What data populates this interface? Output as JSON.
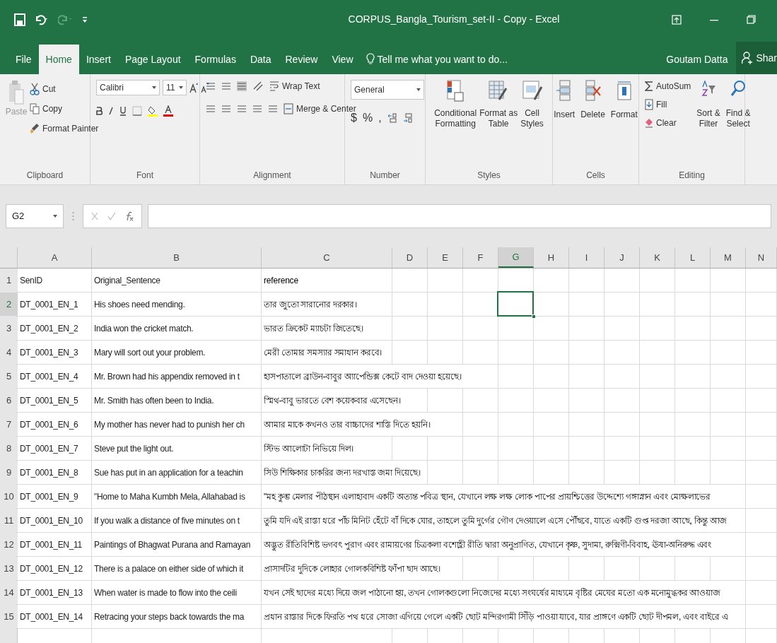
{
  "window": {
    "title": "CORPUS_Bangla_Tourism_set-II - Copy - Excel"
  },
  "tabs": [
    {
      "label": "File",
      "selected": false
    },
    {
      "label": "Home",
      "selected": true
    },
    {
      "label": "Insert",
      "selected": false
    },
    {
      "label": "Page Layout",
      "selected": false
    },
    {
      "label": "Formulas",
      "selected": false
    },
    {
      "label": "Data",
      "selected": false
    },
    {
      "label": "Review",
      "selected": false
    },
    {
      "label": "View",
      "selected": false
    }
  ],
  "tell_me": "Tell me what you want to do...",
  "user": "Goutam Datta",
  "share": "Shar",
  "ribbon": {
    "clipboard": {
      "label": "Clipboard",
      "paste": "Paste",
      "cut": "Cut",
      "copy": "Copy",
      "format_painter": "Format Painter"
    },
    "font": {
      "label": "Font",
      "font_name": "Calibri",
      "font_size": "11"
    },
    "alignment": {
      "label": "Alignment",
      "wrap_text": "Wrap Text",
      "merge_center": "Merge & Center"
    },
    "number": {
      "label": "Number",
      "format": "General",
      "currency": "$",
      "percent": "%",
      "comma": ","
    },
    "styles": {
      "label": "Styles",
      "buttons": [
        {
          "line1": "Conditional",
          "line2": "Formatting"
        },
        {
          "line1": "Format as",
          "line2": "Table"
        },
        {
          "line1": "Cell",
          "line2": "Styles"
        }
      ]
    },
    "cells": {
      "label": "Cells",
      "buttons": [
        "Insert",
        "Delete",
        "Format"
      ]
    },
    "editing": {
      "label": "Editing",
      "autosum": "AutoSum",
      "fill": "Fill",
      "clear": "Clear",
      "sort": {
        "line1": "Sort &",
        "line2": "Filter"
      },
      "find": {
        "line1": "Find &",
        "line2": "Select"
      }
    }
  },
  "name_box": "G2",
  "columns": [
    {
      "label": "A",
      "selected": false
    },
    {
      "label": "B",
      "selected": false
    },
    {
      "label": "C",
      "selected": false
    },
    {
      "label": "D",
      "selected": false
    },
    {
      "label": "E",
      "selected": false
    },
    {
      "label": "F",
      "selected": false
    },
    {
      "label": "G",
      "selected": true
    },
    {
      "label": "H",
      "selected": false
    },
    {
      "label": "I",
      "selected": false
    },
    {
      "label": "J",
      "selected": false
    },
    {
      "label": "K",
      "selected": false
    },
    {
      "label": "L",
      "selected": false
    },
    {
      "label": "M",
      "selected": false
    },
    {
      "label": "N",
      "selected": false
    }
  ],
  "rows": [
    {
      "num": "1",
      "selected": false,
      "cells": [
        "SenID",
        "Original_Sentence",
        "reference"
      ]
    },
    {
      "num": "2",
      "selected": true,
      "cells": [
        "DT_0001_EN_1",
        "His shoes need mending.",
        "তার জুতো সারানোর দরকার।"
      ]
    },
    {
      "num": "3",
      "selected": false,
      "cells": [
        "DT_0001_EN_2",
        "India won the cricket match.",
        "ভারত ক্রিকেট ম্যাচটা জিতেছে।"
      ]
    },
    {
      "num": "4",
      "selected": false,
      "cells": [
        "DT_0001_EN_3",
        "Mary will sort out your problem.",
        "মেরী তোমার সমস্যার সমাধান করবে।"
      ]
    },
    {
      "num": "5",
      "selected": false,
      "cells": [
        "DT_0001_EN_4",
        "Mr. Brown had his appendix removed in t",
        "হাসপাতালে ব্রাউন-বাবুর  অ্যাপেন্ডিক্স কেটে বাদ দেওয়া হয়েছে।"
      ]
    },
    {
      "num": "6",
      "selected": false,
      "cells": [
        "DT_0001_EN_5",
        "Mr. Smith has often been to India.",
        "স্মিথ-বাবু ভারতে বেশ কয়েকবার এসেছেন।"
      ]
    },
    {
      "num": "7",
      "selected": false,
      "cells": [
        "DT_0001_EN_6",
        "My mother has never had to punish her ch",
        "আমার মাকে কখনও তার বাচ্চাদের শাস্তি দিতে হয়নি।"
      ]
    },
    {
      "num": "8",
      "selected": false,
      "cells": [
        "DT_0001_EN_7",
        "Steve put the light out.",
        "স্টিভ আলোটা নিভিয়ে দিল।"
      ]
    },
    {
      "num": "9",
      "selected": false,
      "cells": [
        "DT_0001_EN_8",
        "Sue has put in an application for a teachin",
        "সিউ শিক্ষিকার চাকরির জন্য দরখাস্ত জমা দিয়েছে।"
      ]
    },
    {
      "num": "10",
      "selected": false,
      "cells": [
        "DT_0001_EN_9",
        "\"Home to Maha Kumbh Mela, Allahabad is",
        "\"মহ কুম্ভ মেলার পীঠস্থান এলাহাবাদ একটি অত্যন্ত পবিত্র স্থান, যেখানে  লক্ষ লক্ষ লোক পাপের প্রায়শ্চিত্তের উদ্দেশ্যে গঙ্গাস্নান এবং মোক্ষলাভের"
      ]
    },
    {
      "num": "11",
      "selected": false,
      "cells": [
        "DT_0001_EN_10",
        "If you walk a distance of five minutes on t",
        "তুমি যদি এই রাস্তা ধরে পাঁচ মিনিট হেঁটে বাঁ দিকে ঘোর, তাহলে তুমি দুর্গের গৌণ দেওয়ালে এসে পৌঁছবে, যাতে একটি গুপ্ত দরজা আছে, কিন্তু আজ"
      ]
    },
    {
      "num": "12",
      "selected": false,
      "cells": [
        "DT_0001_EN_11",
        "Paintings of Bhagwat Purana and Ramayan",
        "অদ্ভুত রীতিবিশিষ্ট ভগবৎ পুরাণ এবং রামায়ণের চিত্রকলা বশোহ্লী রীতি দ্বারা অনুপ্রাণিত, যেখানে কৃষ্ণ, সুদামা, রুক্মিণী-বিবাহ, ঊষা-অনিরুদ্ধ এবং"
      ]
    },
    {
      "num": "13",
      "selected": false,
      "cells": [
        "DT_0001_EN_12",
        "There is a palace on either side of which it",
        "প্রাসাদটির দুদিকে লোহার গোলকবিশিষ্ট ফাঁপা ছাদ আছে।"
      ]
    },
    {
      "num": "14",
      "selected": false,
      "cells": [
        "DT_0001_EN_13",
        "When water is made to flow into the ceili",
        "যখন সেই ছাদের মধ্যে দিয়ে জল পাঠানো হয়, তখন গোলকগুলো নিজেদের মধ্যে সংঘর্ষের মাধ্যমে বৃষ্টির মেঘের মতো এক মনোমুগ্ধকর আওয়াজ"
      ]
    },
    {
      "num": "15",
      "selected": false,
      "cells": [
        "DT_0001_EN_14",
        "Retracing your steps back towards the ma",
        "প্রধান রাস্তার দিকে ফিরতি পথ ধরে সোজা এগিয়ে গেলে একটি ছোট মন্দিরগামী সিঁড়ি পাওয়া যাবে, যার প্রাঙ্গণে একটি ছোট দীপমল, এবং বাইরে এ"
      ]
    }
  ]
}
